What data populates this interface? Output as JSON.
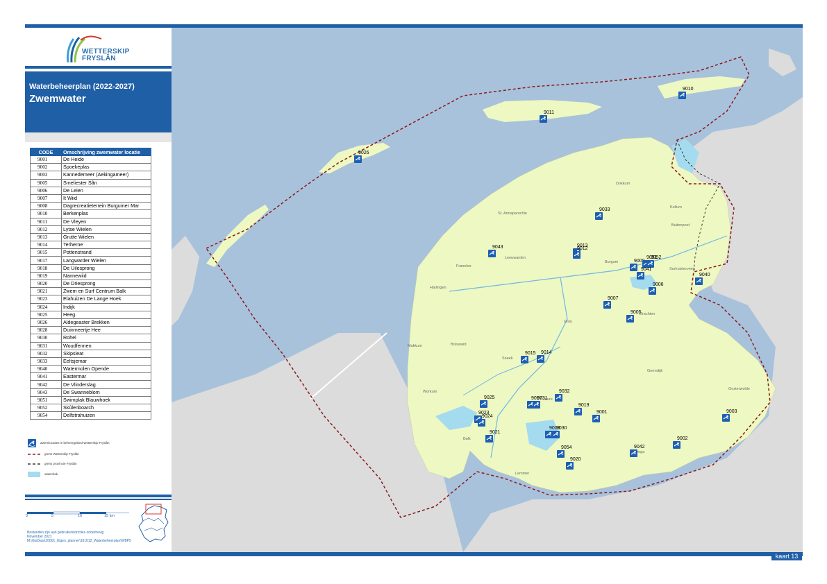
{
  "logo": {
    "name_line1": "WETTERSKIP",
    "name_line2": "FRYSLÂN"
  },
  "header": {
    "title": "Waterbeheerplan (2022-2027)",
    "subtitle": "Zwemwater"
  },
  "table": {
    "columns": [
      "CODE",
      "Omschrijving zwemwater locatie"
    ],
    "rows": [
      [
        "9001",
        "De Heide"
      ],
      [
        "9002",
        "Spoekeplas"
      ],
      [
        "9003",
        "Kannedemeer (Aekingameer)"
      ],
      [
        "9005",
        "Smeliester Sân"
      ],
      [
        "9006",
        "De Leien"
      ],
      [
        "9007",
        "It Wiid"
      ],
      [
        "9008",
        "Dagrecreatieterrein Burgumer Mar"
      ],
      [
        "9010",
        "Berkenplas"
      ],
      [
        "9011",
        "De Vleyen"
      ],
      [
        "9012",
        "Lytse Wielen"
      ],
      [
        "9013",
        "Grutte Wielen"
      ],
      [
        "9014",
        "Terherne"
      ],
      [
        "9015",
        "Pottenstrand"
      ],
      [
        "9017",
        "Langwarder Wielen"
      ],
      [
        "9018",
        "De Uilesprong"
      ],
      [
        "9019",
        "Nannewiid"
      ],
      [
        "9020",
        "De Driesprong"
      ],
      [
        "9021",
        "Zwem en Surf Centrum Balk"
      ],
      [
        "9023",
        "Elahuizen De Lange Hoek"
      ],
      [
        "9024",
        "Indijk"
      ],
      [
        "9025",
        "Heeg"
      ],
      [
        "9026",
        "Aldegeaster Brekken"
      ],
      [
        "9028",
        "Duinmeertje Hee"
      ],
      [
        "9030",
        "Rohel"
      ],
      [
        "9031",
        "Woudfennen"
      ],
      [
        "9032",
        "Skipsleat"
      ],
      [
        "9033",
        "Eeltsjemar"
      ],
      [
        "9040",
        "Watermolen Opende"
      ],
      [
        "9041",
        "Eastermar"
      ],
      [
        "9042",
        "De Vlinderslag"
      ],
      [
        "9043",
        "De Swanneblom"
      ],
      [
        "9051",
        "Swimplak Blauwhoek"
      ],
      [
        "9052",
        "Skûlenboarch"
      ],
      [
        "9054",
        "Delfstrahuizen"
      ]
    ]
  },
  "legend": {
    "swim": "Zwemlocaties in beheergebied Wetterskip Fryslân",
    "border_ws": "grens Wetterskip Fryslân",
    "border_prov": "grens provincie Fryslân",
    "water": "watervlak"
  },
  "scale": {
    "labels": [
      "0",
      "5",
      "10",
      "15 km"
    ]
  },
  "source": {
    "line1": "Bestanden zijn aan gebruiksrestricties onderhevig",
    "line2": "November 2021",
    "line3": "M:\\GisData\\10001_Eigen_planner\\101012_Waterbeheerplan\\WBP5"
  },
  "map": {
    "cities": [
      "Dokkum",
      "Kollum",
      "Buitenpost",
      "St. Annaparochie",
      "Leeuwarden",
      "Burgum",
      "Surhuisterveen",
      "Franeker",
      "Harlingen",
      "Drachten",
      "Grou",
      "Bolsward",
      "Makkum",
      "Sneek",
      "Workum",
      "Joure",
      "Gorredijk",
      "Oosterwolde",
      "Balk",
      "Wolvega",
      "Lemmer"
    ],
    "sites": [
      "9010",
      "9011",
      "9026",
      "9033",
      "9043",
      "9013",
      "9012",
      "9008",
      "9051",
      "9052",
      "9041",
      "9006",
      "9040",
      "9007",
      "9005",
      "9015",
      "9014",
      "9032",
      "9025",
      "9017",
      "9031",
      "9019",
      "9001",
      "9023",
      "9024",
      "9021",
      "9018",
      "9030",
      "9054",
      "9020",
      "9042",
      "9002",
      "9003"
    ]
  },
  "footer": {
    "sheet": "kaart 13"
  },
  "colors": {
    "brand_blue": "#1f5fa6",
    "land": "#eef8c2",
    "sea": "#a9c2dc",
    "border_red": "#8b1a1a"
  }
}
